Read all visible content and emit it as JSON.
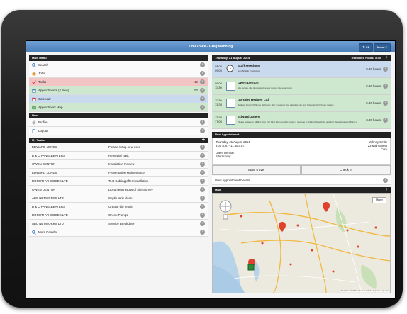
{
  "app": {
    "title": "TimeTrack - Greg Manning"
  },
  "topbar": {
    "sync_label": "↻ 31",
    "menu_label": "Menu ≡"
  },
  "left": {
    "main_menu_header": "Main Menu",
    "menu": [
      {
        "label": "Search",
        "count": ""
      },
      {
        "label": "Jobs",
        "count": ""
      },
      {
        "label": "Tasks",
        "count": "19"
      },
      {
        "label": "Appointments (2 New)",
        "count": "50"
      },
      {
        "label": "Calendar",
        "count": ""
      },
      {
        "label": "Appointment Map",
        "count": ""
      }
    ],
    "user_header": "User",
    "user_items": [
      {
        "label": "Profile"
      },
      {
        "label": "Logout"
      }
    ],
    "tasks_header": "My Tasks",
    "tasks": [
      {
        "customer": "EDWARD JONES",
        "task": "Please setup new user"
      },
      {
        "customer": "B & C PANELBEATERS",
        "task": "Remedial Task"
      },
      {
        "customer": "OWEN DENTON",
        "task": "Installation Review"
      },
      {
        "customer": "EDWARD JONES",
        "task": "Preventative Maintenance"
      },
      {
        "customer": "DOROTHY HEDGES LTD",
        "task": "Test Cabling after Installation"
      },
      {
        "customer": "OWEN DENTON",
        "task": "Document results of Site Survey"
      },
      {
        "customer": "ABC NETWORKS LTD",
        "task": "Septic tank clean"
      },
      {
        "customer": "B & C PANELBEATERS",
        "task": "Grease bin repair"
      },
      {
        "customer": "DOROTHY HEDGES LTD",
        "task": "Check Pumps"
      },
      {
        "customer": "ABC NETWORKS LTD",
        "task": "Service Breakdown"
      }
    ],
    "more_results": "More Results"
  },
  "right": {
    "day_header": "Thursday, 21 August 2014",
    "recorded_hours": "Recorded Hours: 8.30",
    "appointments": [
      {
        "start": "08:00",
        "end": "09:00",
        "name": "Staff Meetings",
        "desc": "Non-Billable Productive",
        "hours": "0.00 hours"
      },
      {
        "start": "09:00",
        "end": "11:30",
        "name": "Owen Denton",
        "desc": "Site survey, site photos and review current site equipment",
        "hours": "2.00 hours"
      },
      {
        "start": "11:30",
        "end": "13:30",
        "name": "Dorothy Hedges Ltd",
        "desc": "Replace fans in Ryllands Bathroom (2x). Customer has asked to cap one hole prior to fit these replace.",
        "hours": "2.00 hours"
      },
      {
        "start": "13:30",
        "end": "17:00",
        "name": "Edward Jones",
        "desc": "Please replace in Sliding Door (4x) First job is used to create a new one in finished directly by updating the attributes of fitting p",
        "hours": "3.00 hours"
      }
    ],
    "next_header": "Next Appointment",
    "next": {
      "date": "Thursday, 21 August 2014",
      "time": "9:00 a.m. - 11:30 a.m.",
      "contact": "Johnny Smith",
      "addr1": "23 Main Street",
      "addr2": "Core",
      "customer": "Owen Denton",
      "type": "Site Survey",
      "start_travel": "Start Travel",
      "check_in": "Check In",
      "view_details": "View Appointment Details"
    },
    "map_header": "Map",
    "map": {
      "type_button": "Map ≡",
      "footer": "Map data ©2014 Google  Terms of Use  Report a map error"
    }
  }
}
